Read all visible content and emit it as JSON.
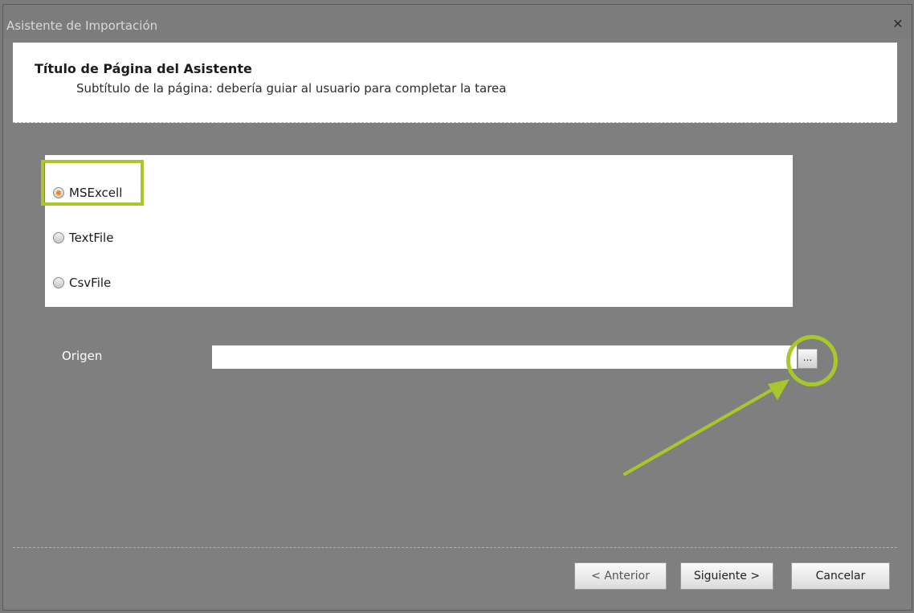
{
  "window": {
    "title": "Asistente de Importación",
    "close_icon": "close-icon"
  },
  "header": {
    "title": "Título de Página del Asistente",
    "subtitle": "Subtítulo de la página: debería guiar al usuario para completar la tarea"
  },
  "options": {
    "items": [
      {
        "label": "MSExcell",
        "checked": true
      },
      {
        "label": "TextFile",
        "checked": false
      },
      {
        "label": "CsvFile",
        "checked": false
      }
    ]
  },
  "origen": {
    "label": "Origen",
    "value": "",
    "browse_label": "..."
  },
  "footer": {
    "prev_label": "< Anterior",
    "next_label": "Siguiente >",
    "cancel_label": "Cancelar"
  },
  "colors": {
    "highlight": "#a8c82a",
    "radio_checked": "#f08b1a",
    "background": "#7f7f7f"
  }
}
